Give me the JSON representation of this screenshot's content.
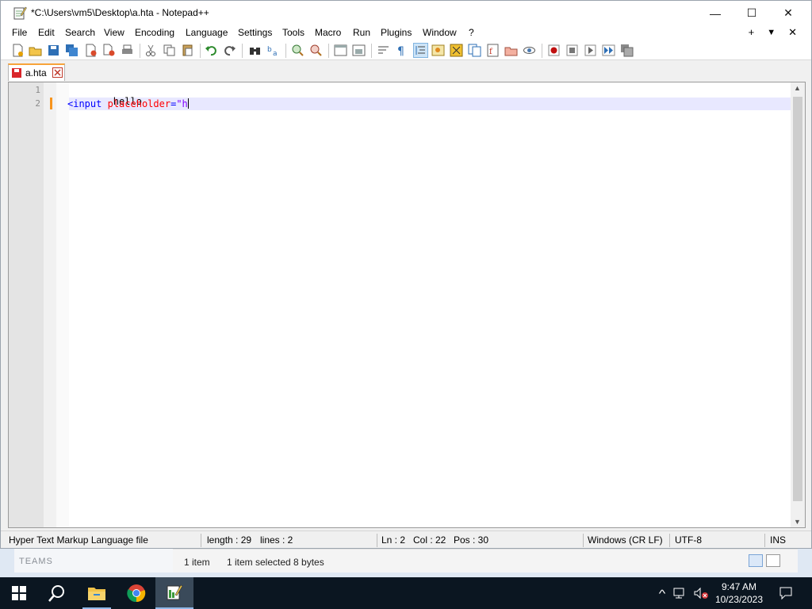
{
  "window": {
    "title": "*C:\\Users\\vm5\\Desktop\\a.hta - Notepad++",
    "controls": {
      "minimize": "—",
      "maximize": "☐",
      "close": "✕"
    }
  },
  "menu": {
    "items": [
      "File",
      "Edit",
      "Search",
      "View",
      "Encoding",
      "Language",
      "Settings",
      "Tools",
      "Macro",
      "Run",
      "Plugins",
      "Window",
      "?"
    ],
    "right": {
      "add": "+",
      "dropdown": "▼",
      "close": "✕"
    }
  },
  "tab": {
    "label": "a.hta"
  },
  "editor": {
    "line_numbers": [
      "1",
      "2"
    ],
    "line1": "hello",
    "line2": {
      "tag": "<input",
      "space": " ",
      "attr": "placeholder",
      "eq": "=",
      "str": "\"h"
    }
  },
  "status": {
    "filetype": "Hyper Text Markup Language file",
    "length": "length : 29",
    "lines": "lines : 2",
    "ln": "Ln : 2",
    "col": "Col : 22",
    "pos": "Pos : 30",
    "eol": "Windows (CR LF)",
    "encoding": "UTF-8",
    "mode": "INS"
  },
  "explorer_bg": {
    "left_label": "TEAMS",
    "items_count": "1 item",
    "selection": "1 item selected  8 bytes"
  },
  "taskbar": {
    "time": "9:47 AM",
    "date": "10/23/2023",
    "tray_chevron": "^"
  },
  "colors": {
    "accent_tab": "#f7a33a",
    "current_line": "#e8e8ff",
    "tag": "#0000ff",
    "attr": "#ff0000",
    "string": "#8000ff"
  }
}
